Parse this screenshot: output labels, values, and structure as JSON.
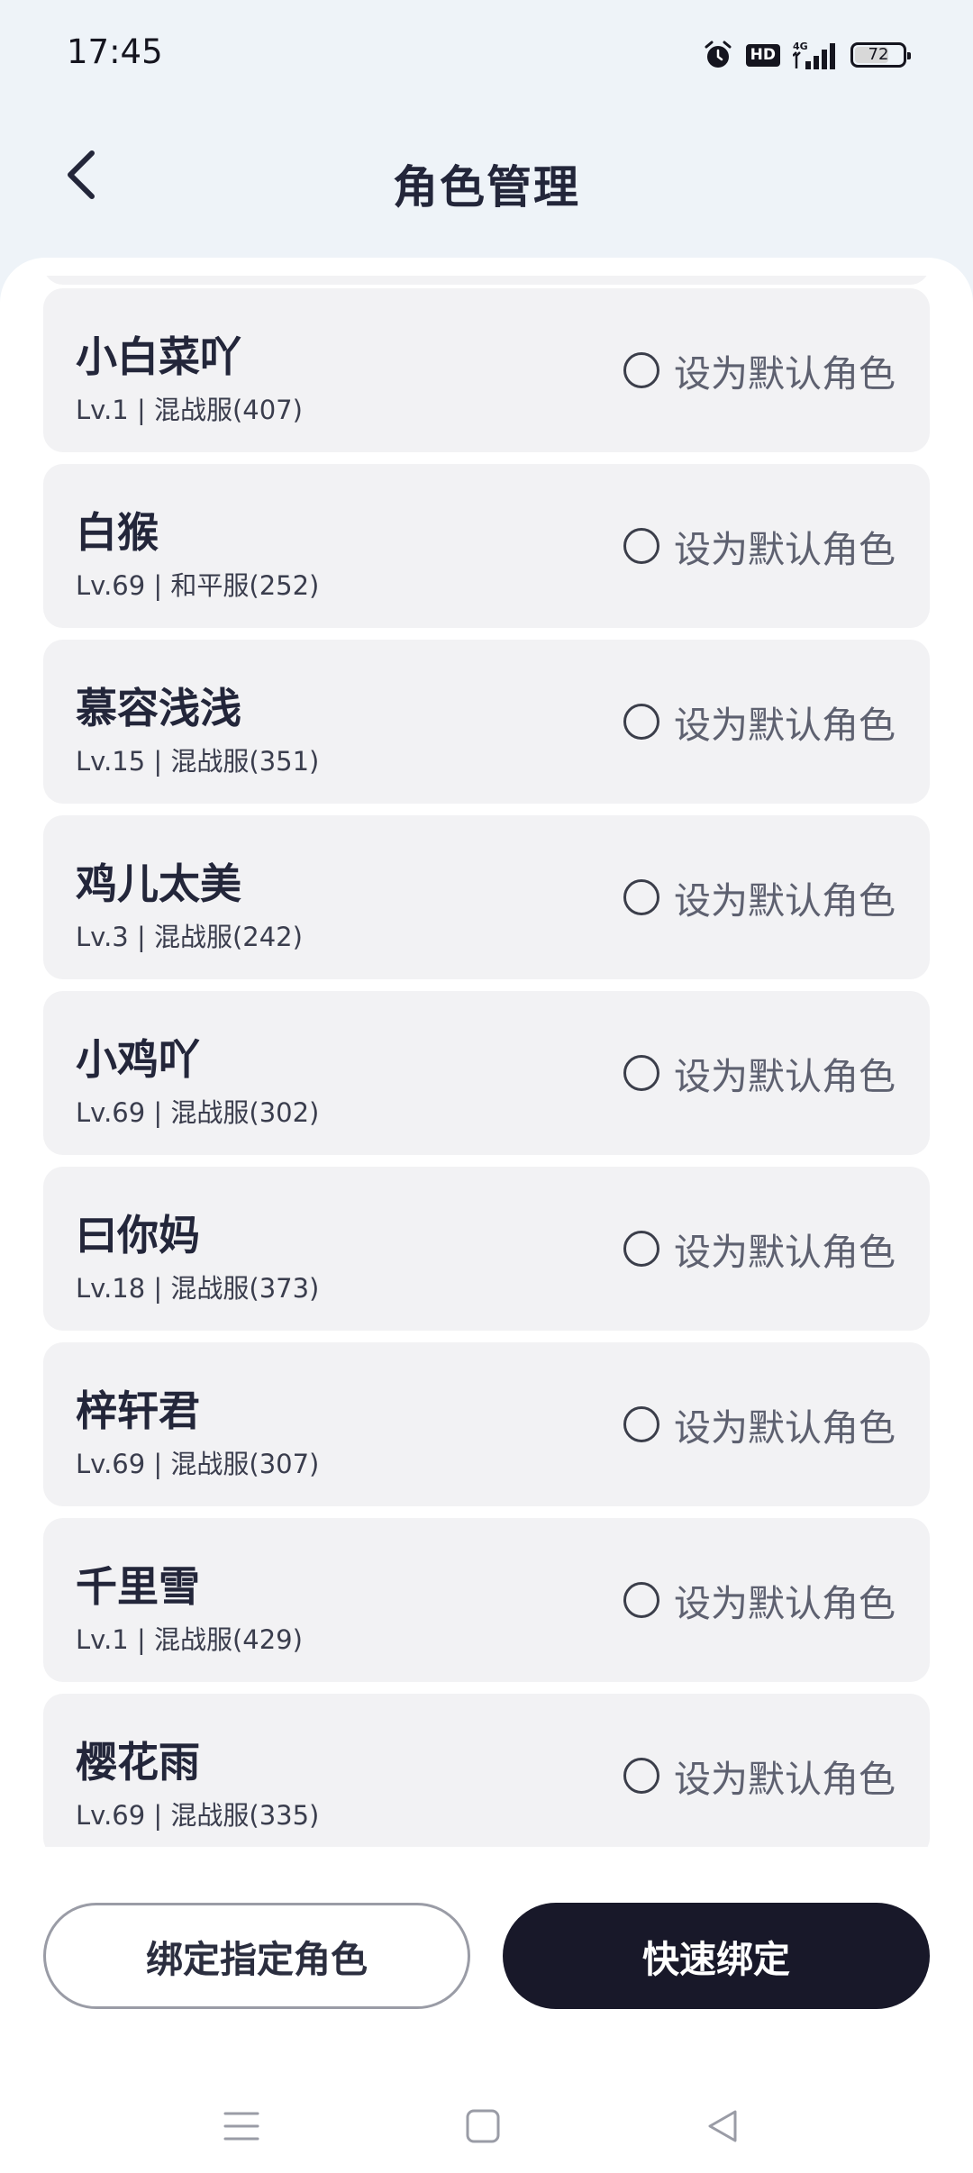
{
  "status": {
    "time": "17:45",
    "hd": "HD",
    "network": "4G",
    "battery": "72",
    "battery_level": 0.72
  },
  "header": {
    "title": "角色管理"
  },
  "toggle_label": "设为默认角色",
  "roles": [
    {
      "name": "小白菜吖",
      "meta": "Lv.1 | 混战服(407)"
    },
    {
      "name": "白猴",
      "meta": "Lv.69 | 和平服(252)"
    },
    {
      "name": "慕容浅浅",
      "meta": "Lv.15 | 混战服(351)"
    },
    {
      "name": "鸡儿太美",
      "meta": "Lv.3 | 混战服(242)"
    },
    {
      "name": "小鸡吖",
      "meta": "Lv.69 | 混战服(302)"
    },
    {
      "name": "曰你妈",
      "meta": "Lv.18 | 混战服(373)"
    },
    {
      "name": "梓轩君",
      "meta": "Lv.69 | 混战服(307)"
    },
    {
      "name": "千里雪",
      "meta": "Lv.1 | 混战服(429)"
    },
    {
      "name": "樱花雨",
      "meta": "Lv.69 | 混战服(335)"
    }
  ],
  "actions": {
    "bind_specific": "绑定指定角色",
    "quick_bind": "快速绑定"
  },
  "nav": {
    "menu_icon": "menu-icon",
    "home_icon": "home-icon",
    "back_icon": "back-triangle-icon"
  }
}
